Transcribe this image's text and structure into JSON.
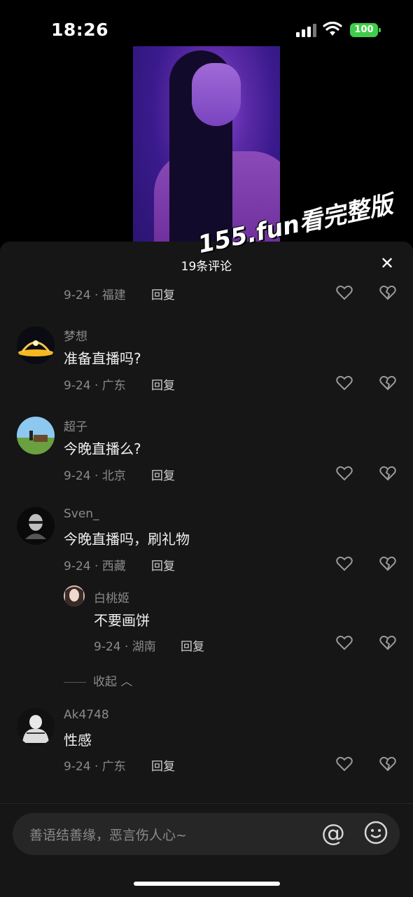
{
  "status": {
    "time": "18:26",
    "battery": "100"
  },
  "sheet": {
    "title": "19条评论",
    "watermark": "155.fun看完整版"
  },
  "comments": [
    {
      "meta": "9-24 · 福建",
      "reply": "回复"
    },
    {
      "name": "梦想",
      "text": "准备直播吗?",
      "meta": "9-24 · 广东",
      "reply": "回复"
    },
    {
      "name": "超子",
      "text": "今晚直播么?",
      "meta": "9-24 · 北京",
      "reply": "回复"
    },
    {
      "name": "Sven_",
      "text": "今晚直播吗，刷礼物",
      "meta": "9-24 · 西藏",
      "reply": "回复"
    },
    {
      "name": "白桃姬",
      "text": "不要画饼",
      "meta": "9-24 · 湖南",
      "reply": "回复"
    },
    {
      "name": "Ak4748",
      "text": "性感",
      "meta": "9-24 · 广东",
      "reply": "回复"
    }
  ],
  "collapse_label": "收起",
  "input": {
    "placeholder": "善语结善缘，恶言伤人心~"
  },
  "icons": {
    "like": "heart-icon",
    "dislike": "broken-heart-icon",
    "mention": "at-icon",
    "emoji": "smiley-icon",
    "close": "close-icon"
  }
}
